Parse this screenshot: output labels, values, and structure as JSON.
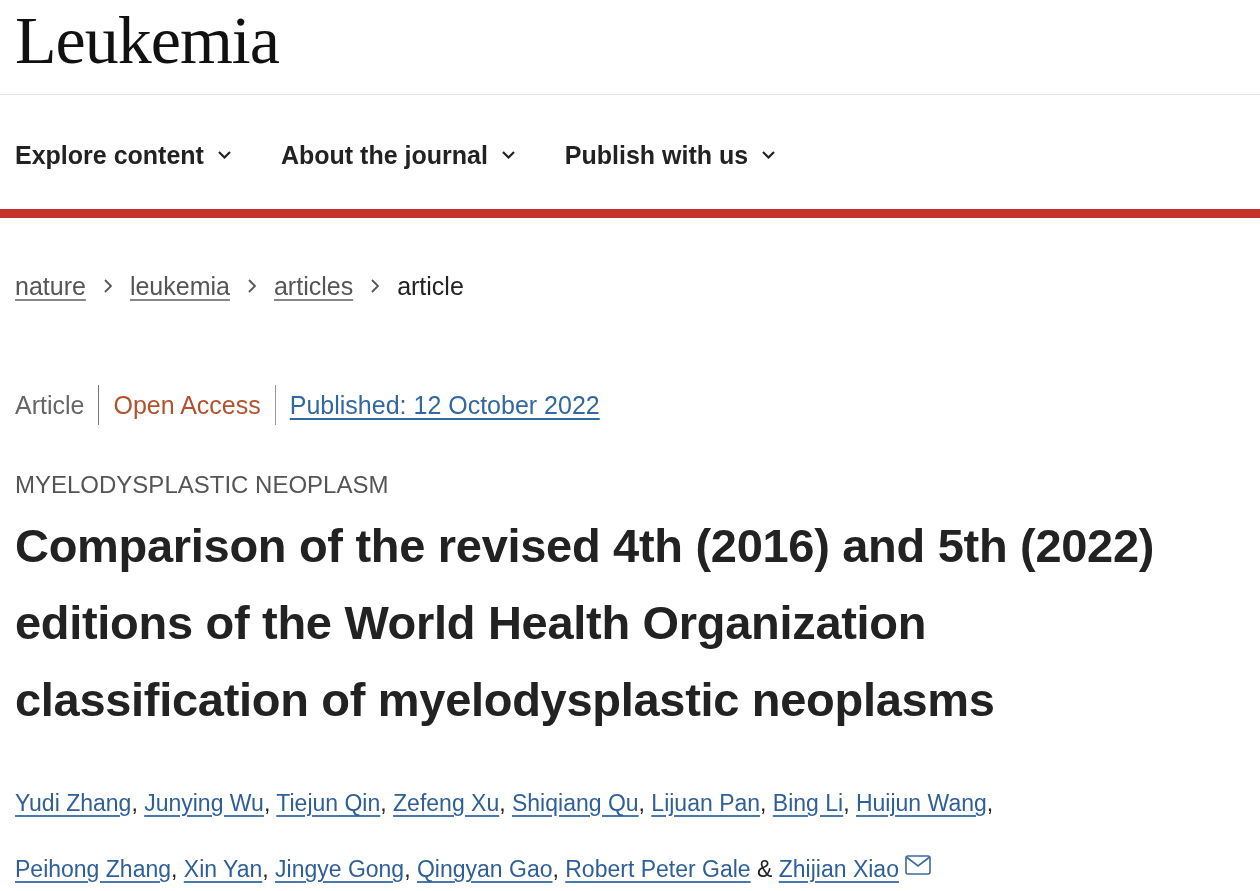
{
  "header": {
    "logo": "Leukemia"
  },
  "nav": {
    "items": [
      {
        "label": "Explore content"
      },
      {
        "label": "About the journal"
      },
      {
        "label": "Publish with us"
      }
    ]
  },
  "breadcrumb": [
    {
      "label": "nature",
      "current": false
    },
    {
      "label": "leukemia",
      "current": false
    },
    {
      "label": "articles",
      "current": false
    },
    {
      "label": "article",
      "current": true
    }
  ],
  "article": {
    "type": "Article",
    "access": "Open Access",
    "published": "Published: 12 October 2022",
    "subject": "MYELODYSPLASTIC NEOPLASM",
    "title": "Comparison of the revised 4th (2016) and 5th (2022) editions of the World Health Organization classification of myelodysplastic neoplasms",
    "authors": [
      {
        "name": "Yudi Zhang",
        "separator": ", ",
        "corresponding": false
      },
      {
        "name": "Junying Wu",
        "separator": ", ",
        "corresponding": false
      },
      {
        "name": "Tiejun Qin",
        "separator": ", ",
        "corresponding": false
      },
      {
        "name": "Zefeng Xu",
        "separator": ", ",
        "corresponding": false
      },
      {
        "name": "Shiqiang Qu",
        "separator": ", ",
        "corresponding": false
      },
      {
        "name": "Lijuan Pan",
        "separator": ", ",
        "corresponding": false
      },
      {
        "name": "Bing Li",
        "separator": ", ",
        "corresponding": false
      },
      {
        "name": "Huijun Wang",
        "separator": ", ",
        "corresponding": false
      },
      {
        "name": "Peihong Zhang",
        "separator": ", ",
        "corresponding": false
      },
      {
        "name": "Xin Yan",
        "separator": ", ",
        "corresponding": false
      },
      {
        "name": "Jingye Gong",
        "separator": ", ",
        "corresponding": false
      },
      {
        "name": "Qingyan Gao",
        "separator": ", ",
        "corresponding": false
      },
      {
        "name": "Robert Peter Gale",
        "separator": " & ",
        "corresponding": false
      },
      {
        "name": "Zhijian Xiao",
        "corresponding": true
      }
    ]
  }
}
